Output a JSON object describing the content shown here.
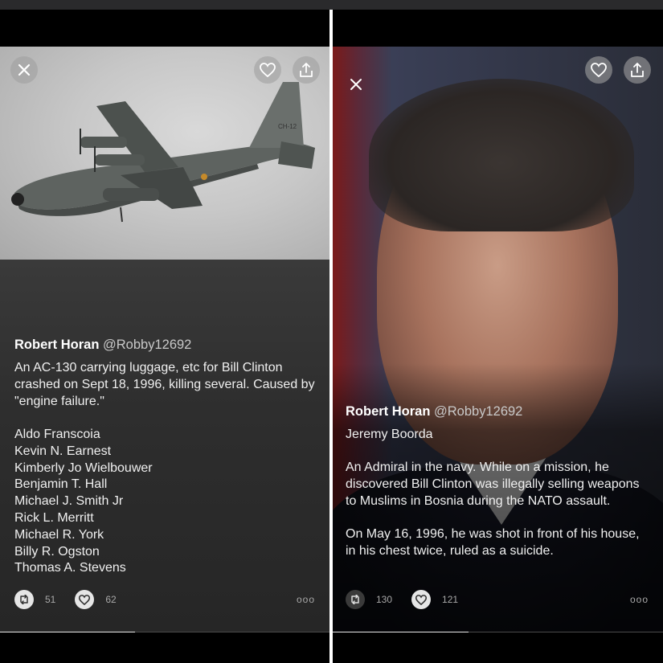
{
  "icons": {
    "close": "close-icon",
    "heart": "heart-icon",
    "share": "share-icon",
    "retweet": "retweet-icon",
    "like": "like-icon",
    "more": "more-icon"
  },
  "left_post": {
    "author_name": "Robert Horan",
    "author_handle": "@Robby12692",
    "aircraft_marking": "CH-12",
    "text": "An AC-130 carrying luggage, etc for Bill Clinton crashed on Sept 18, 1996, killing several. Caused by \"engine failure.\"",
    "names": [
      "Aldo Franscoia",
      "Kevin N. Earnest",
      "Kimberly Jo Wielbouwer",
      "Benjamin T. Hall",
      "Michael J. Smith Jr",
      "Rick L. Merritt",
      "Michael R. York",
      "Billy R. Ogston",
      "Thomas A. Stevens"
    ],
    "retweets": "51",
    "likes": "62",
    "more": "ooo",
    "progress": 0.41
  },
  "right_post": {
    "author_name": "Robert Horan",
    "author_handle": "@Robby12692",
    "subject": "Jeremy Boorda",
    "text_1": "An Admiral in the navy. While on a mission, he discovered Bill Clinton was illegally selling weapons to Muslims in Bosnia during the NATO assault.",
    "text_2": "On May 16, 1996, he was shot in front of his house, in his chest twice, ruled as a suicide.",
    "retweets": "130",
    "likes": "121",
    "more": "ooo",
    "progress": 0.41
  },
  "colors": {
    "background": "#000000",
    "card": "#2e2e2e",
    "text": "#ffffff",
    "muted": "#a8a8a8"
  }
}
